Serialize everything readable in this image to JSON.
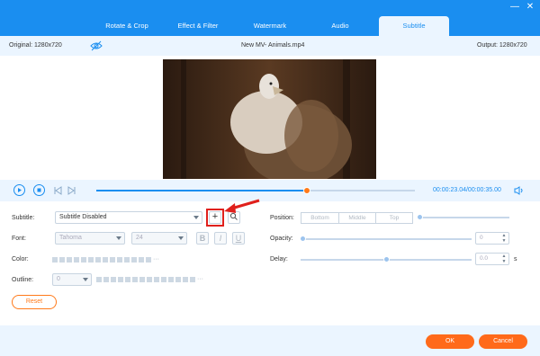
{
  "tabs": [
    {
      "label": "Rotate & Crop"
    },
    {
      "label": "Effect & Filter"
    },
    {
      "label": "Watermark"
    },
    {
      "label": "Audio"
    },
    {
      "label": "Subtitle"
    }
  ],
  "active_tab": "Subtitle",
  "info": {
    "original": "Original: 1280x720",
    "filename": "New MV- Animals.mp4",
    "output": "Output: 1280x720"
  },
  "player": {
    "time": "00:00:23.04/00:00:35.00",
    "progress": 0.66
  },
  "subtitle": {
    "label": "Subtitle:",
    "value": "Subtitle Disabled"
  },
  "font": {
    "label": "Font:",
    "family": "Tahoma",
    "size": "24",
    "bold": "B",
    "italic": "I",
    "underline": "U"
  },
  "color": {
    "label": "Color:"
  },
  "outline": {
    "label": "Outline:",
    "value": "0"
  },
  "position": {
    "label": "Position:",
    "options": [
      "Bottom",
      "Middle",
      "Top"
    ],
    "slider": 0.0
  },
  "opacity": {
    "label": "Opacity:",
    "value": "0",
    "slider": 0.0
  },
  "delay": {
    "label": "Delay:",
    "value": "0.0",
    "unit": "s",
    "slider": 0.5
  },
  "buttons": {
    "reset": "Reset",
    "ok": "OK",
    "cancel": "Cancel",
    "add": "+"
  },
  "colors": {
    "accent": "#1a8ef0",
    "orange": "#ff6a1a",
    "highlight": "#e0201c"
  }
}
